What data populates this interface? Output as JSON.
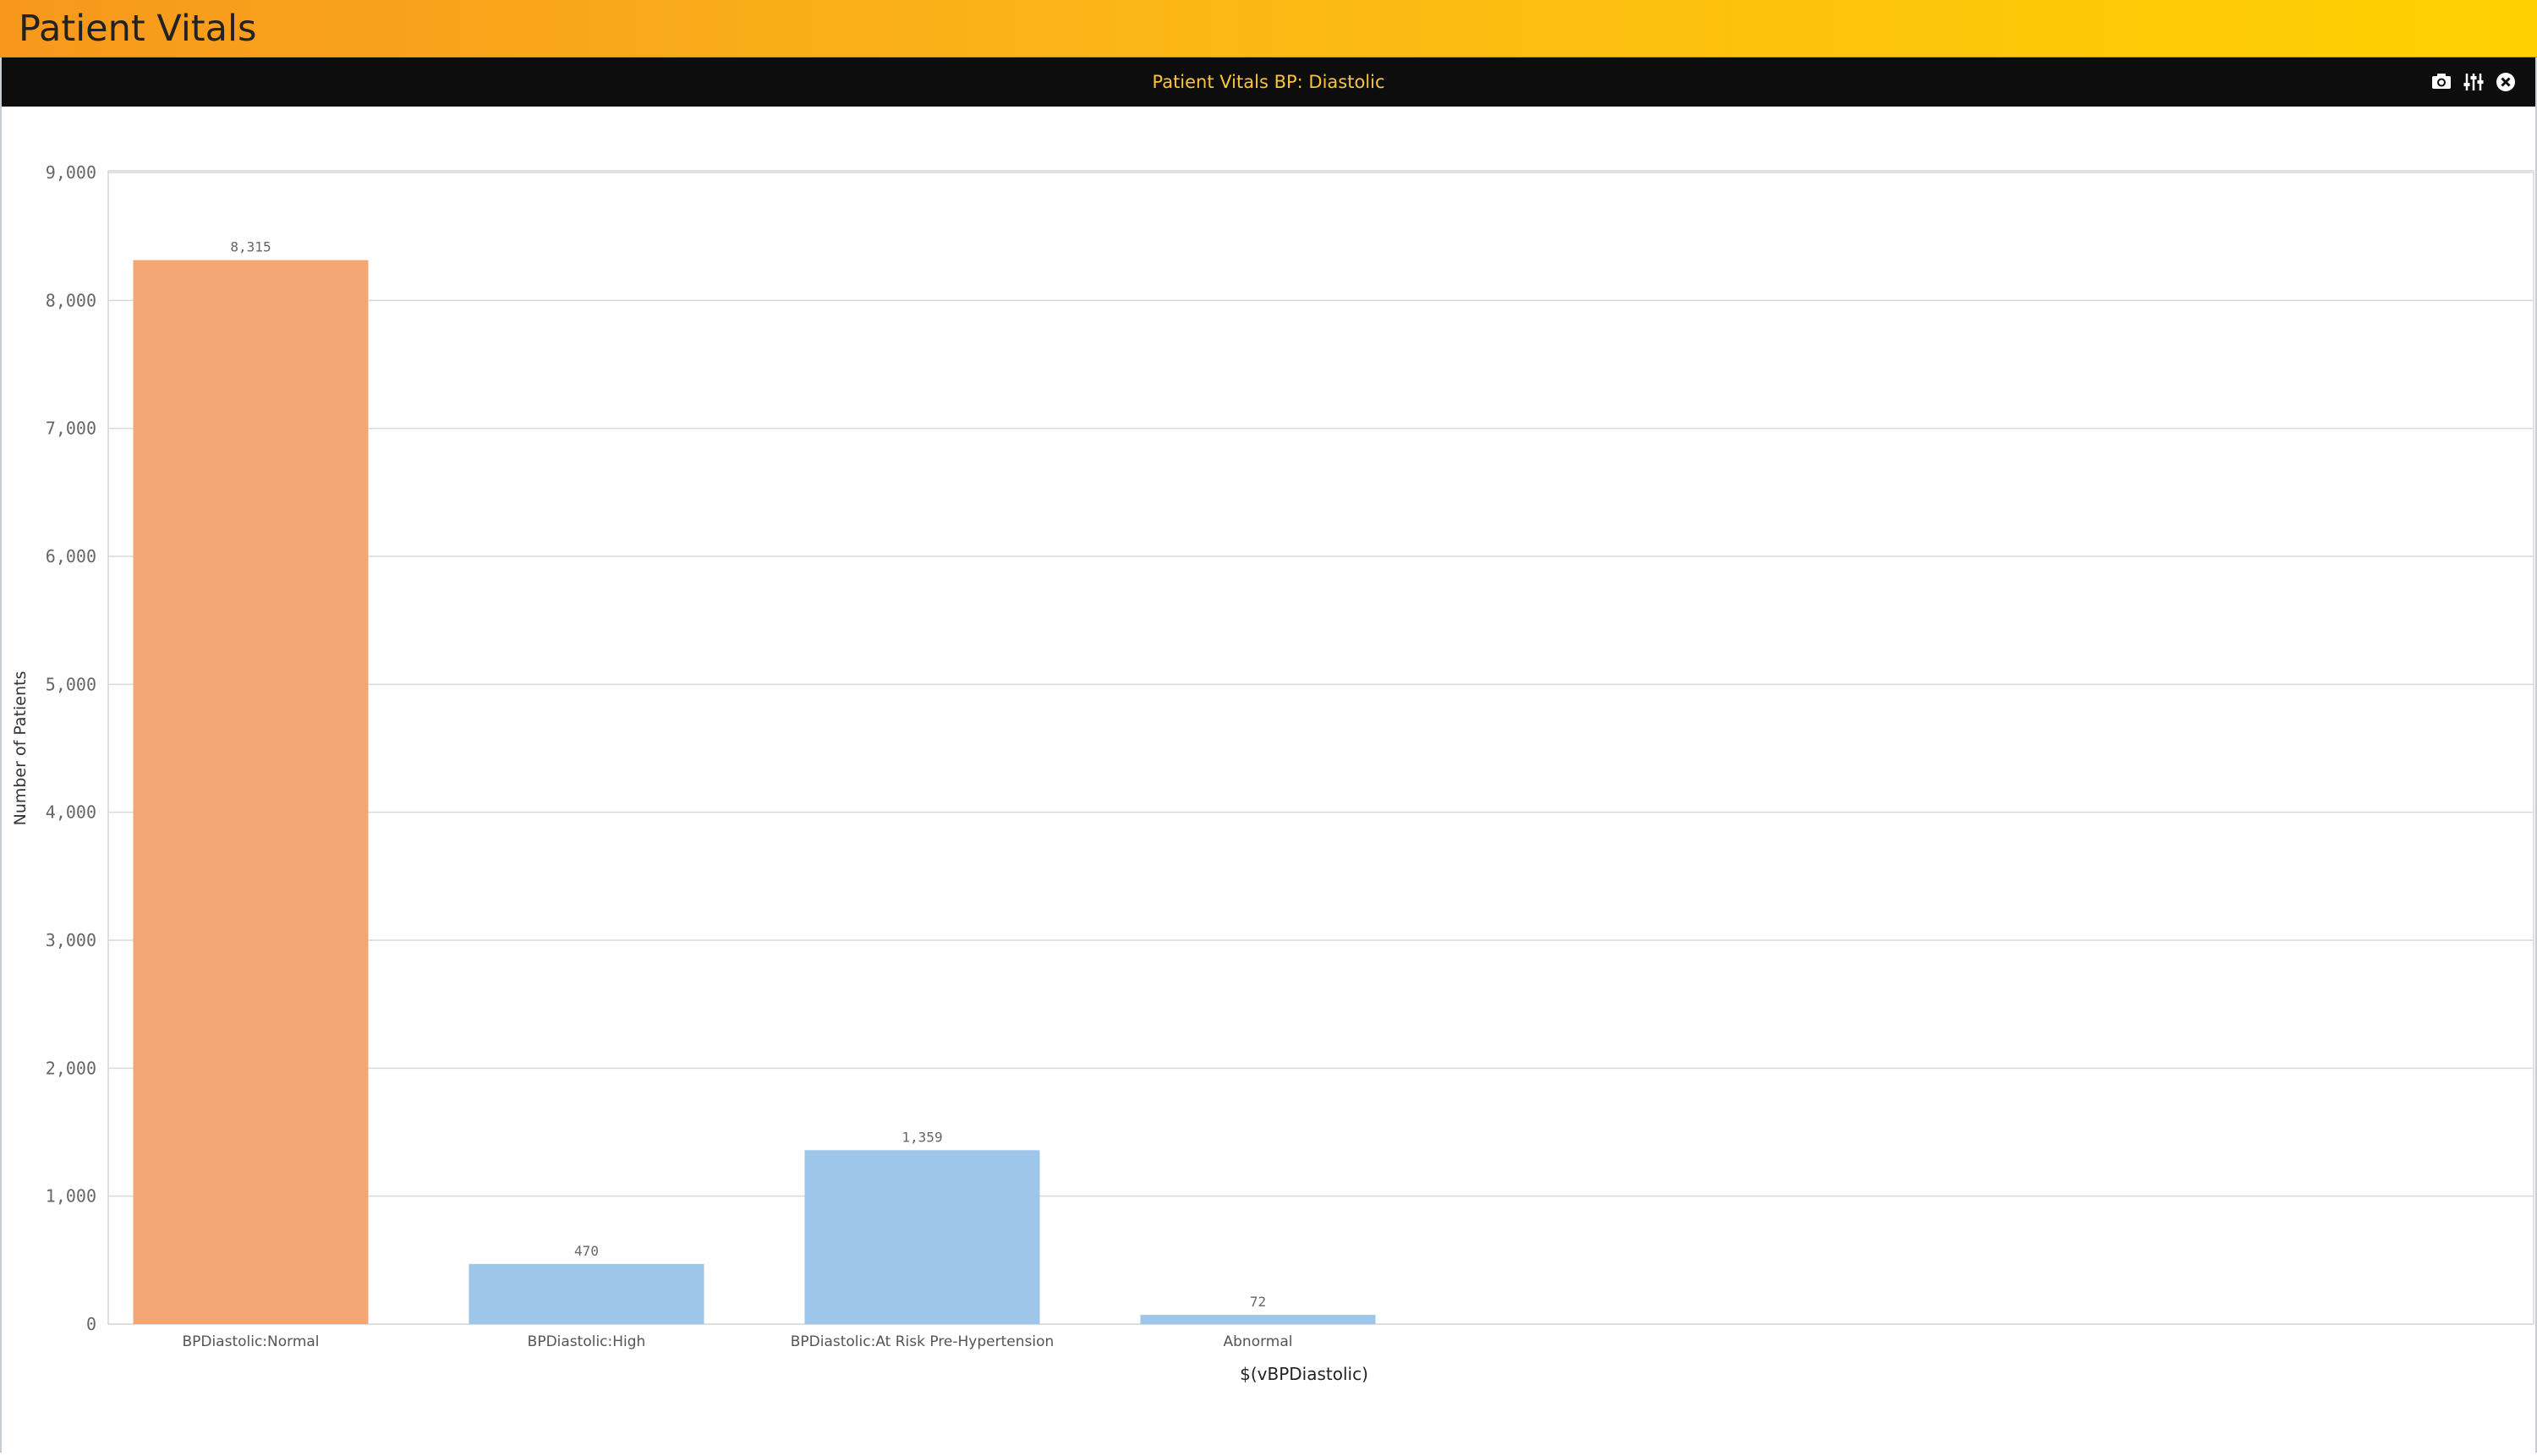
{
  "app": {
    "title": "Patient Vitals"
  },
  "panel": {
    "title": "Patient Vitals BP: Diastolic",
    "tools": [
      {
        "name": "camera-icon"
      },
      {
        "name": "sliders-icon"
      },
      {
        "name": "close-icon"
      }
    ]
  },
  "colors": {
    "highlight_bar": "#f4a574",
    "bar": "#9dc6ea",
    "header_bg": "#0d0d0d",
    "header_text": "#f7c43a"
  },
  "chart_data": {
    "type": "bar",
    "categories": [
      "BPDiastolic:Normal",
      "BPDiastolic:High",
      "BPDiastolic:At Risk Pre-Hypertension",
      "Abnormal"
    ],
    "values": [
      8315,
      470,
      1359,
      72
    ],
    "data_labels": [
      "8,315",
      "470",
      "1,359",
      "72"
    ],
    "xlabel": "$(vBPDiastolic)",
    "ylabel": "Number of Patients",
    "ylim": [
      0,
      9000
    ],
    "yticks": [
      0,
      1000,
      2000,
      3000,
      4000,
      5000,
      6000,
      7000,
      8000,
      9000
    ],
    "ytick_labels": [
      "0",
      "1,000",
      "2,000",
      "3,000",
      "4,000",
      "5,000",
      "6,000",
      "7,000",
      "8,000",
      "9,000"
    ],
    "grid": true,
    "highlighted_category": "BPDiastolic:Normal"
  }
}
